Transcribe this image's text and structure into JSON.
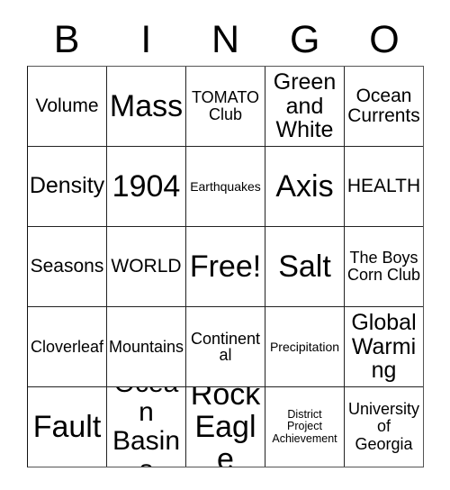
{
  "card": {
    "header_letters": [
      "B",
      "I",
      "N",
      "G",
      "O"
    ],
    "rows": [
      [
        {
          "text": "Volume",
          "size": "md"
        },
        {
          "text": "Mass",
          "size": "xxl"
        },
        {
          "text": "TOMATO\nClub",
          "size": "sm"
        },
        {
          "text": "Green\nand\nWhite",
          "size": "lg"
        },
        {
          "text": "Ocean\nCurrents",
          "size": "md"
        }
      ],
      [
        {
          "text": "Density",
          "size": "lg"
        },
        {
          "text": "1904",
          "size": "xxl"
        },
        {
          "text": "Earthquakes",
          "size": "xs"
        },
        {
          "text": "Axis",
          "size": "xxl"
        },
        {
          "text": "HEALTH",
          "size": "md"
        }
      ],
      [
        {
          "text": "Seasons",
          "size": "md"
        },
        {
          "text": "WORLD",
          "size": "md"
        },
        {
          "text": "Free!",
          "size": "xxl"
        },
        {
          "text": "Salt",
          "size": "xxl"
        },
        {
          "text": "The Boys\nCorn Club",
          "size": "sm"
        }
      ],
      [
        {
          "text": "Cloverleaf",
          "size": "sm"
        },
        {
          "text": "Mountains",
          "size": "sm"
        },
        {
          "text": "Continental",
          "size": "sm"
        },
        {
          "text": "Precipitation",
          "size": "xs"
        },
        {
          "text": "Global\nWarming",
          "size": "lg"
        }
      ],
      [
        {
          "text": "Fault",
          "size": "xxl"
        },
        {
          "text": "Ocean\nBasins",
          "size": "xl"
        },
        {
          "text": "Rock\nEagle",
          "size": "xxl"
        },
        {
          "text": "District\nProject\nAchievement",
          "size": "xxs"
        },
        {
          "text": "University\nof\nGeorgia",
          "size": "sm"
        }
      ]
    ],
    "free_space": {
      "row": 2,
      "col": 2,
      "label": "Free!"
    }
  },
  "colors": {
    "background": "#ffffff",
    "text": "#000000",
    "grid_line": "#222222"
  }
}
